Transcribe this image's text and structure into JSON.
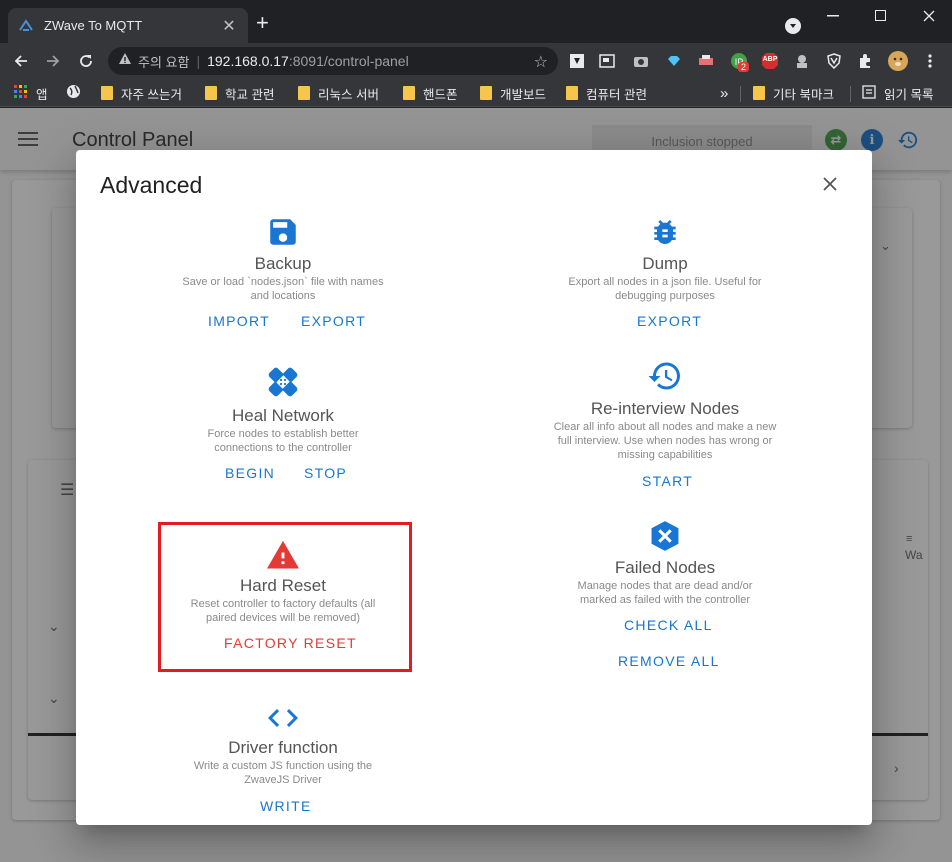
{
  "browser": {
    "tab": {
      "title": "ZWave To MQTT"
    },
    "omnibox": {
      "security_warning": "주의 요함",
      "url_host": "192.168.0.17",
      "url_rest": ":8091/control-panel"
    },
    "extensions": {
      "badge_count": "2",
      "abp_label": "ABP"
    },
    "bookmarks": {
      "items": [
        {
          "label": "앱"
        },
        {
          "label": "자주 쓰는거"
        },
        {
          "label": "학교 관련"
        },
        {
          "label": "리눅스 서버"
        },
        {
          "label": "핸드폰"
        },
        {
          "label": "개발보드"
        },
        {
          "label": "컴퓨터 관련"
        }
      ],
      "overflow": "»",
      "other": "기타 북마크",
      "reading_list": "읽기 목록"
    }
  },
  "app": {
    "title": "Control Panel",
    "inclusion_status": "Inclusion stopped",
    "table_header_partial": "Wa",
    "icon_colors": {
      "green": "#43a047",
      "blue": "#1976d2"
    }
  },
  "dialog": {
    "title": "Advanced",
    "actions": {
      "backup": {
        "title": "Backup",
        "desc": "Save or load `nodes.json` file with names and locations",
        "buttons": [
          "IMPORT",
          "EXPORT"
        ],
        "icon": "save-icon"
      },
      "dump": {
        "title": "Dump",
        "desc": "Export all nodes in a json file. Useful for debugging purposes",
        "buttons": [
          "EXPORT"
        ],
        "icon": "bug-icon"
      },
      "heal": {
        "title": "Heal Network",
        "desc": "Force nodes to establish better connections to the controller",
        "buttons": [
          "BEGIN",
          "STOP"
        ],
        "icon": "bandage-icon"
      },
      "reinterview": {
        "title": "Re-interview Nodes",
        "desc": "Clear all info about all nodes and make a new full interview. Use when nodes has wrong or missing capabilities",
        "buttons": [
          "START"
        ],
        "icon": "history-icon"
      },
      "hard_reset": {
        "title": "Hard Reset",
        "desc": "Reset controller to factory defaults (all paired devices will be removed)",
        "buttons": [
          "FACTORY RESET"
        ],
        "icon": "warning-icon"
      },
      "failed": {
        "title": "Failed Nodes",
        "desc": "Manage nodes that are dead and/or marked as failed with the controller",
        "buttons": [
          "CHECK ALL",
          "REMOVE ALL"
        ],
        "icon": "close-circle-icon"
      },
      "driver": {
        "title": "Driver function",
        "desc": "Write a custom JS function using the ZwaveJS Driver",
        "buttons": [
          "WRITE"
        ],
        "icon": "code-icon"
      }
    },
    "colors": {
      "primary": "#1976d2",
      "danger": "#e53935",
      "highlight_border": "#e31b23"
    }
  }
}
